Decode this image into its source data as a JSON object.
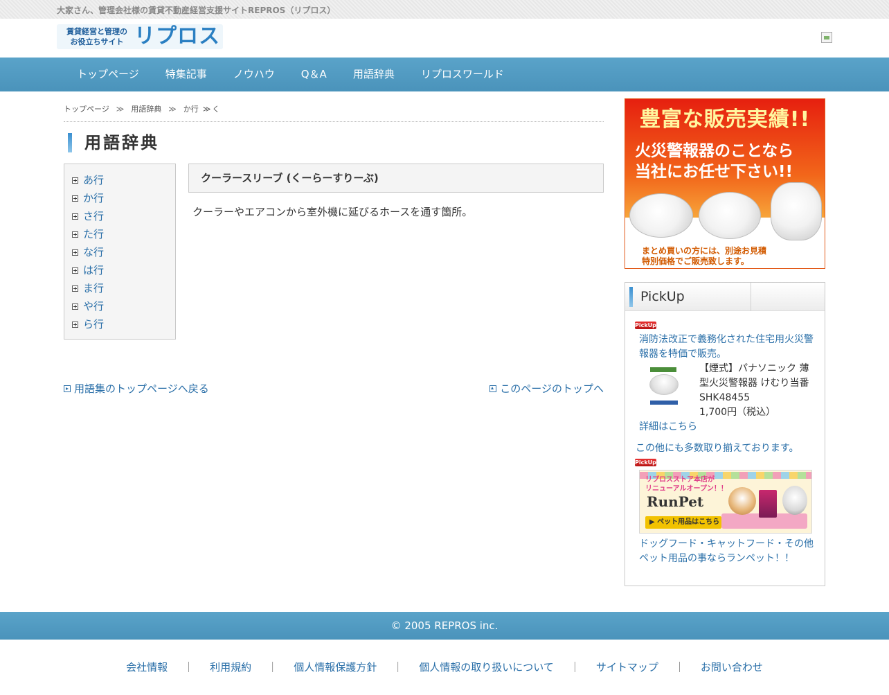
{
  "top_strip": {
    "tagline": "大家さん、管理会社様の賃貸不動産経営支援サイトREPROS（リプロス）"
  },
  "header": {
    "logo_sub_line1": "賃貸経営と管理の",
    "logo_sub_line2": "お役立ちサイト",
    "logo_main": "リプロス"
  },
  "nav": {
    "items": [
      {
        "label": "トップページ"
      },
      {
        "label": "特集記事"
      },
      {
        "label": "ノウハウ"
      },
      {
        "label": "Q＆A"
      },
      {
        "label": "用語辞典"
      },
      {
        "label": "リプロスワールド"
      }
    ]
  },
  "breadcrumb": {
    "items": [
      "トップページ",
      "用語辞典",
      "か行"
    ],
    "separator": "≫",
    "current": "く"
  },
  "page_title": "用語辞典",
  "index": {
    "items": [
      {
        "label": "あ行"
      },
      {
        "label": "か行"
      },
      {
        "label": "さ行"
      },
      {
        "label": "た行"
      },
      {
        "label": "な行"
      },
      {
        "label": "は行"
      },
      {
        "label": "ま行"
      },
      {
        "label": "や行"
      },
      {
        "label": "ら行"
      }
    ]
  },
  "term": {
    "heading": "クーラースリーブ (くーらーすりーぶ)",
    "definition": "クーラーやエアコンから室外機に延びるホースを通す箇所。"
  },
  "links": {
    "back": "用語集のトップページへ戻る",
    "top": "このページのトップへ"
  },
  "ad": {
    "line1": "豊富な販売実績!!",
    "line2": "火災警報器のことなら",
    "line3": "当社にお任せ下さい!!",
    "line4": "まとめ買いの方には、別途お見積",
    "line5": "特別価格でご販売致します。"
  },
  "pickup": {
    "title": "PickUp",
    "badge": "PickUp!",
    "item1_headline": "消防法改正で義務化された住宅用火災警報器を特価で販売。",
    "item1_product": "【煙式】パナソニック 薄型火災警報器 けむり当番 SHK48455",
    "item1_price": "1,700円（税込）",
    "item1_detail": "詳細はこちら",
    "more_text": "この他にも多数取り揃えております。",
    "runpet_line1": "リプロスストア本店が",
    "runpet_line2": "リニューアルオープン！！",
    "runpet_logo": "RunPet",
    "runpet_button": "▶ ペット用品はこちら",
    "item2_text": "ドッグフード・キャットフード・その他ペット用品の事ならランペット！！"
  },
  "footer": {
    "copyright": "© 2005 REPROS inc.",
    "links": [
      {
        "label": "会社情報"
      },
      {
        "label": "利用規約"
      },
      {
        "label": "個人情報保護方針"
      },
      {
        "label": "個人情報の取り扱いについて"
      },
      {
        "label": "サイトマップ"
      },
      {
        "label": "お問い合わせ"
      }
    ],
    "separator": "｜"
  },
  "colors": {
    "nav_blue": "#4a93bb",
    "link_blue": "#2a6fa8",
    "ad_red": "#e6200f"
  }
}
